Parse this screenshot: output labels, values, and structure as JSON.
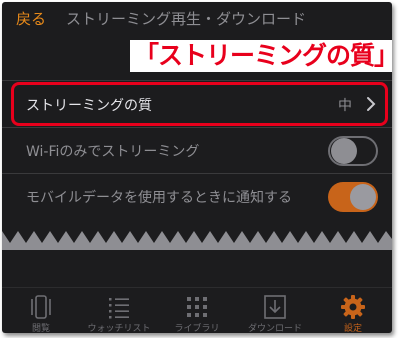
{
  "header": {
    "back_label": "戻る",
    "title": "ストリーミング再生・ダウンロード"
  },
  "callout": "「ストリーミングの質」",
  "settings": [
    {
      "label": "ストリーミングの質",
      "value": "中",
      "control": "disclosure"
    },
    {
      "label": "Wi-Fiのみでストリーミング",
      "control": "toggle",
      "state": "off"
    },
    {
      "label": "モバイルデータを使用するときに通知する",
      "control": "toggle",
      "state": "on"
    }
  ],
  "tabs": [
    {
      "label": "閲覧",
      "icon": "browse-icon",
      "active": false
    },
    {
      "label": "ウォッチリスト",
      "icon": "list-icon",
      "active": false
    },
    {
      "label": "ライブラリ",
      "icon": "grid-icon",
      "active": false
    },
    {
      "label": "ダウンロード",
      "icon": "download-icon",
      "active": false
    },
    {
      "label": "設定",
      "icon": "gear-icon",
      "active": true
    }
  ],
  "colors": {
    "accent": "#e88a1a",
    "highlight": "#e8001c",
    "background": "#1c1c1e"
  }
}
